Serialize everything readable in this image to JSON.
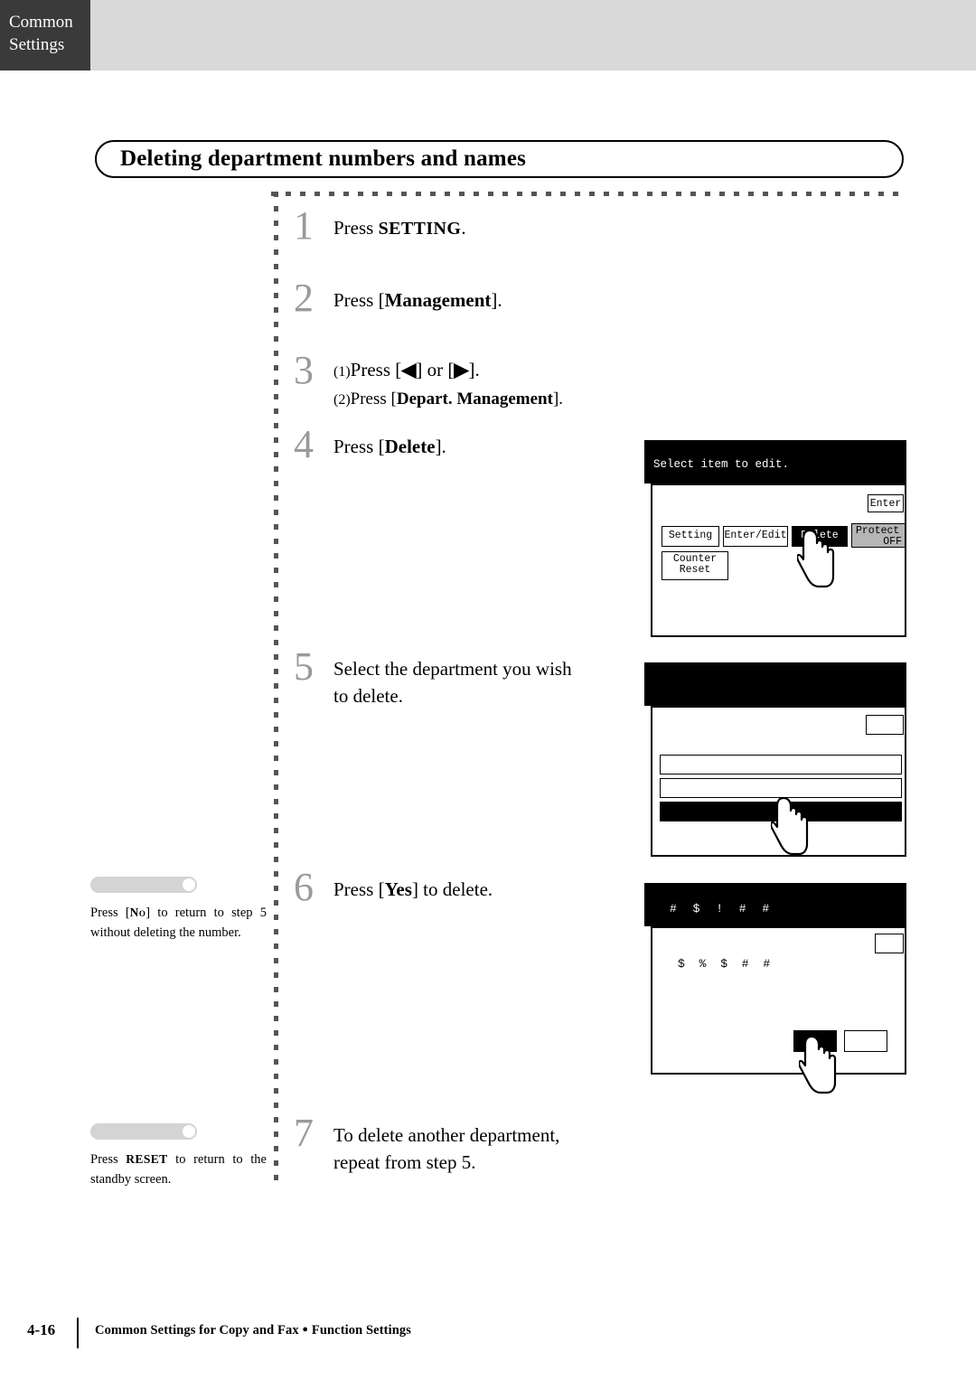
{
  "header": {
    "tab_line1": "Common",
    "tab_line2": "Settings"
  },
  "title": "Deleting department numbers and names",
  "steps": [
    {
      "number": "1",
      "text_before": "Press ",
      "key": "SETTING",
      "text_after": "."
    },
    {
      "number": "2",
      "text_before": "Press [",
      "key": "Management",
      "text_after": "]."
    },
    {
      "number": "3",
      "sub1_label": "(1)",
      "sub1_before": "Press [",
      "sub1_key1": "◀",
      "sub1_mid": "] or [",
      "sub1_key2": "▶",
      "sub1_after": "].",
      "sub2_label": "(2)",
      "sub2_before": "Press [",
      "sub2_key": "Depart. Management",
      "sub2_after": "]."
    },
    {
      "number": "4",
      "text_before": "Press [",
      "key": "Delete",
      "text_after": "]."
    },
    {
      "number": "5",
      "line1": "Select the department you wish",
      "line2": "to delete."
    },
    {
      "number": "6",
      "text_before": "Press [",
      "key": "Yes",
      "text_after": "] to delete."
    },
    {
      "number": "7",
      "line1": "To delete another department,",
      "line2": "repeat from step 5."
    }
  ],
  "notes": [
    {
      "line1": "Press [",
      "key": "No",
      "line2": "] to return to",
      "line3": "step 5 without deleting",
      "line4": "the number."
    },
    {
      "line1": "Press ",
      "key": "RESET",
      "line2": " to return to",
      "line3": "the standby screen."
    }
  ],
  "panel4": {
    "title": "Select item to edit.",
    "enter_key": "Enter",
    "keys": [
      "Setting",
      "Enter/Edit",
      "Delete"
    ],
    "protect_label": "Protect",
    "protect_state": "OFF",
    "counter_line1": "Counter",
    "counter_line2": "Reset"
  },
  "panel5": {
    "rows": [
      "",
      "",
      ""
    ]
  },
  "panel6": {
    "titlebar": "#  $ ! #   #",
    "dialog_text": "$  % $    #    #"
  },
  "footer": {
    "page": "4-16",
    "text_left": "Common Settings for Copy and Fax ",
    "bullet": "●",
    "text_right": " Function Settings"
  }
}
